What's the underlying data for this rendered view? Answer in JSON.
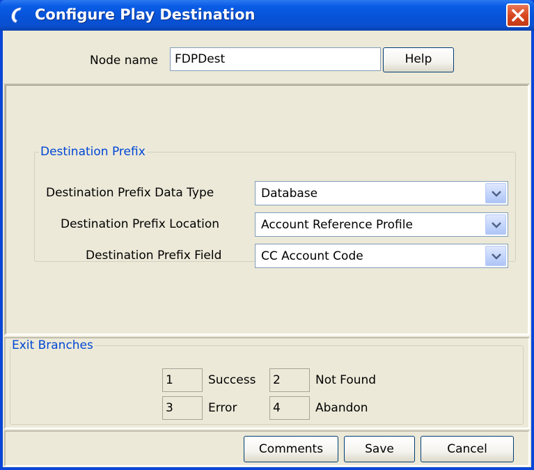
{
  "window": {
    "title": "Configure Play Destination"
  },
  "node": {
    "label": "Node name",
    "value": "FDPDest",
    "help_label": "Help"
  },
  "destination_prefix": {
    "group_title": "Destination Prefix",
    "fields": [
      {
        "label": "Destination Prefix Data Type",
        "value": "Database"
      },
      {
        "label": "Destination Prefix Location",
        "value": "Account Reference Profile"
      },
      {
        "label": "Destination Prefix Field",
        "value": "CC Account Code"
      }
    ]
  },
  "exit_branches": {
    "group_title": "Exit Branches",
    "branches": [
      {
        "number": "1",
        "label": "Success"
      },
      {
        "number": "2",
        "label": "Not Found"
      },
      {
        "number": "3",
        "label": "Error"
      },
      {
        "number": "4",
        "label": "Abandon"
      }
    ]
  },
  "footer": {
    "comments_label": "Comments",
    "save_label": "Save",
    "cancel_label": "Cancel"
  },
  "icons": {
    "title": "phone-handset-icon",
    "close": "close-icon",
    "dropdown": "chevron-down-icon"
  },
  "colors": {
    "titlebar": "#0653d8",
    "dialog_bg": "#ece9d8",
    "group_title": "#0046d5",
    "close_button": "#d8471f"
  }
}
